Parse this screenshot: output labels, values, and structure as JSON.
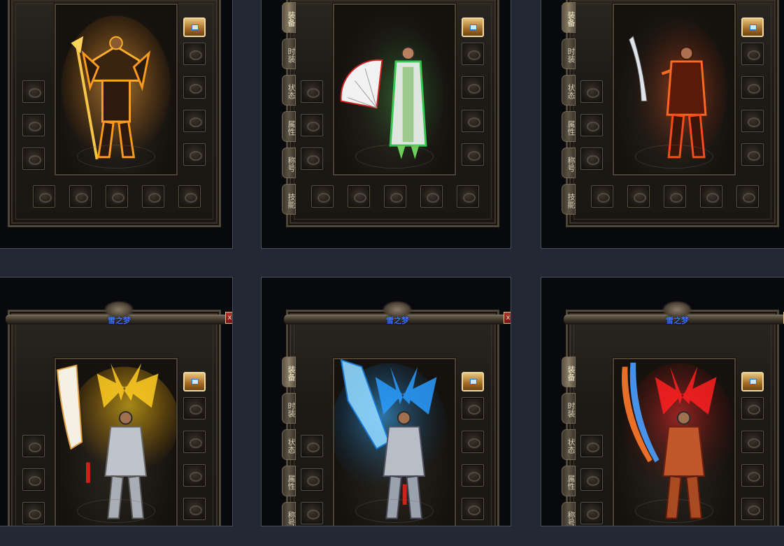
{
  "window_title": "雪之梦",
  "close_label": "x",
  "tabs": [
    "装备",
    "时装",
    "状态",
    "属性",
    "称号",
    "技能"
  ],
  "cards": [
    {
      "id": "gold-armor",
      "theme": "#ff9a1a",
      "accent": "#ffd35a",
      "weapon": "spear",
      "title_visible": false,
      "tabs_visible": false
    },
    {
      "id": "white-fan",
      "theme": "#3bd45a",
      "accent": "#ffffff",
      "weapon": "fan",
      "title_visible": false,
      "tabs_visible": true
    },
    {
      "id": "red-blade",
      "theme": "#ff4a1a",
      "accent": "#ffd1a0",
      "weapon": "blade",
      "title_visible": false,
      "tabs_visible": true
    },
    {
      "id": "gold-wings",
      "theme": "#ffc81a",
      "accent": "#fff2b0",
      "weapon": "greatsword",
      "title_visible": true,
      "tabs_visible": false
    },
    {
      "id": "ice-wings",
      "theme": "#2fa8ff",
      "accent": "#bfefff",
      "weapon": "iceblade",
      "title_visible": true,
      "tabs_visible": true
    },
    {
      "id": "fire-wings",
      "theme": "#ff2a2a",
      "accent": "#4aa0ff",
      "weapon": "dualblade",
      "title_visible": true,
      "tabs_visible": true
    }
  ]
}
